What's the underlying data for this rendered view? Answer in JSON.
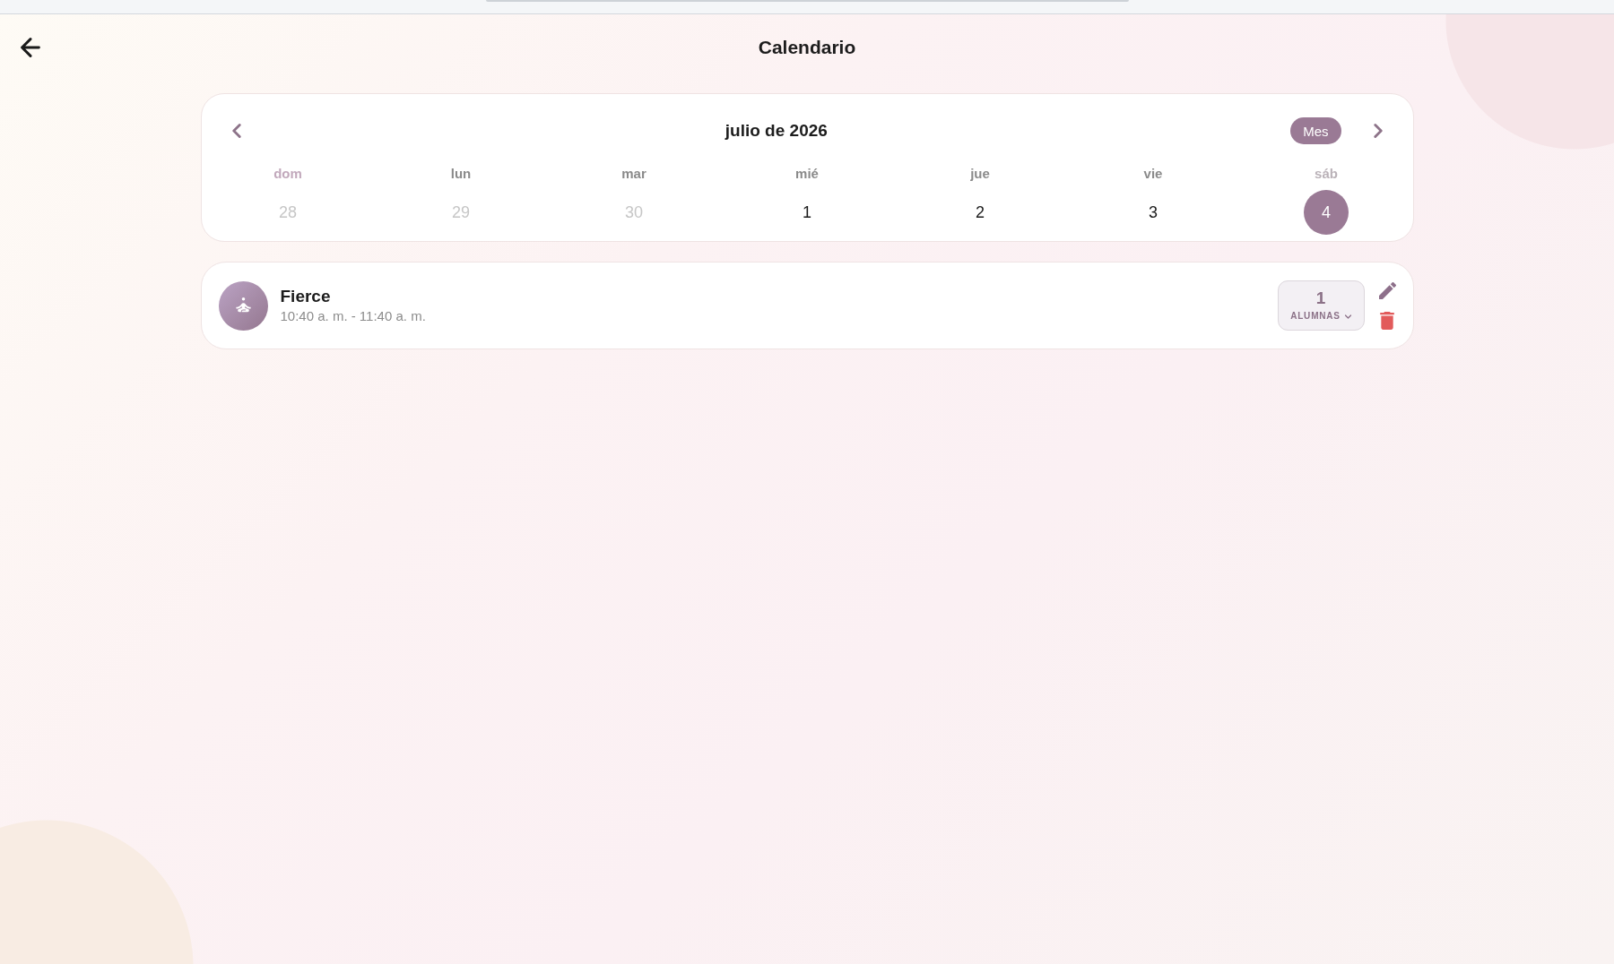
{
  "header": {
    "title": "Calendario"
  },
  "calendar": {
    "month_title": "julio de 2026",
    "view_button": "Mes",
    "weekdays": [
      {
        "label": "dom",
        "kind": "sunday"
      },
      {
        "label": "lun",
        "kind": "weekday"
      },
      {
        "label": "mar",
        "kind": "weekday"
      },
      {
        "label": "mié",
        "kind": "weekday"
      },
      {
        "label": "jue",
        "kind": "weekday"
      },
      {
        "label": "vie",
        "kind": "weekday"
      },
      {
        "label": "sáb",
        "kind": "saturday"
      }
    ],
    "days": [
      {
        "label": "28",
        "outside_month": true,
        "selected": false
      },
      {
        "label": "29",
        "outside_month": true,
        "selected": false
      },
      {
        "label": "30",
        "outside_month": true,
        "selected": false
      },
      {
        "label": "1",
        "outside_month": false,
        "selected": false
      },
      {
        "label": "2",
        "outside_month": false,
        "selected": false
      },
      {
        "label": "3",
        "outside_month": false,
        "selected": false
      },
      {
        "label": "4",
        "outside_month": false,
        "selected": true
      }
    ]
  },
  "sessions": [
    {
      "title": "Fierce",
      "time": "10:40 a. m. - 11:40 a. m.",
      "attendees": {
        "count": "1",
        "label": "ALUMNAS"
      }
    }
  ]
}
